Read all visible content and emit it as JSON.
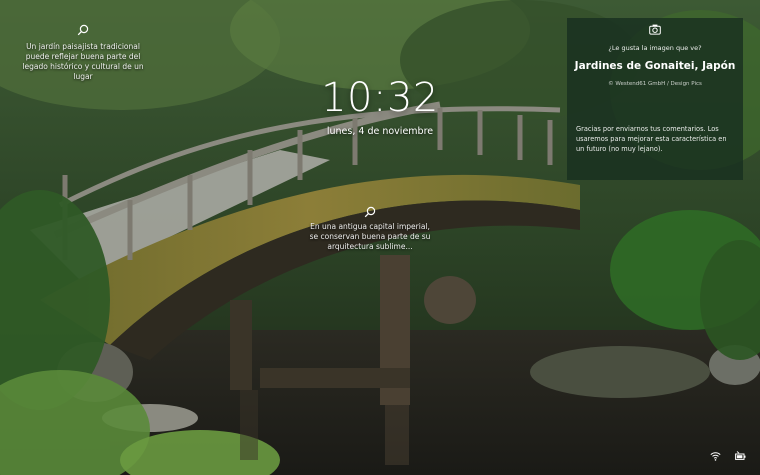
{
  "lockscreen": {
    "time": "10:32",
    "date": "lunes, 4 de noviembre"
  },
  "hotspots": [
    {
      "icon": "search-icon",
      "text": "Un jardín paisajista tradicional puede reflejar buena parte del legado histórico y cultural de un lugar"
    },
    {
      "icon": "search-icon",
      "text": "En una antigua capital imperial, se conservan buena parte de su arquitectura sublime..."
    }
  ],
  "spotlight_panel": {
    "icon": "camera-icon",
    "question": "¿Le gusta la imagen que ve?",
    "title": "Jardines de Gonaitei, Japón",
    "credit": "© Westend61 GmbH / Design Pics",
    "thanks": "Gracias por enviarnos tus comentarios. Los usaremos para mejorar esta característica en un futuro (no muy lejano)."
  },
  "tray": {
    "icons": [
      "wifi-icon",
      "battery-icon"
    ]
  },
  "colors": {
    "panel_bg": "#183020",
    "text": "#ffffff"
  }
}
